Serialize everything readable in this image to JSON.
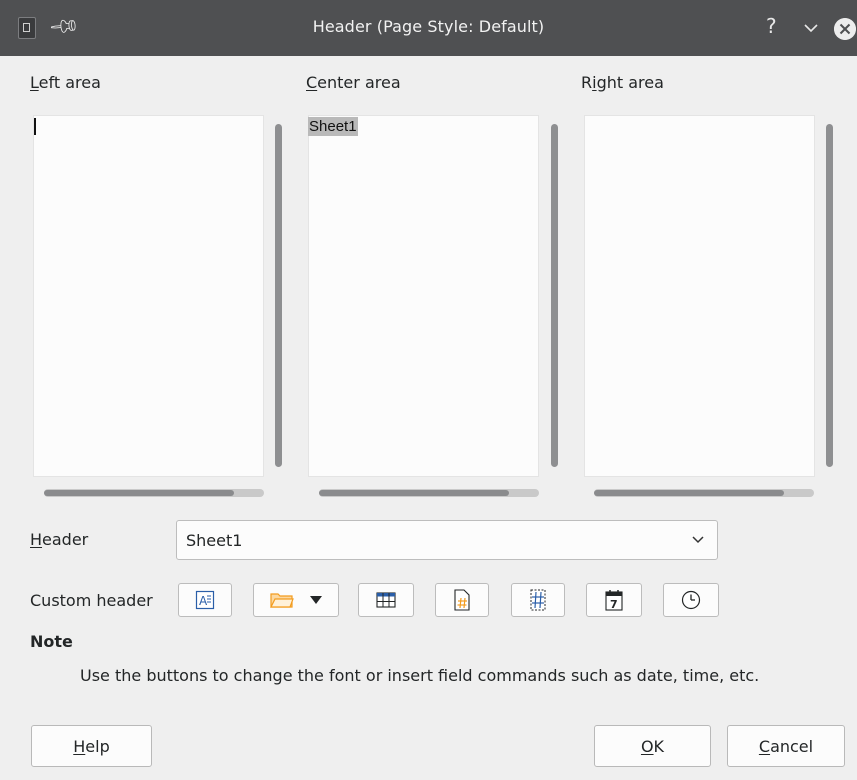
{
  "window": {
    "title": "Header (Page Style: Default)",
    "help_glyph": "?"
  },
  "areas": {
    "left": {
      "label_first": "L",
      "label_rest": "eft area",
      "content": ""
    },
    "center": {
      "label_first": "C",
      "label_rest": "enter area",
      "content": "Sheet1"
    },
    "right": {
      "label_pre": "R",
      "label_mid": "i",
      "label_rest": "ght area",
      "content": ""
    }
  },
  "header": {
    "label_first": "H",
    "label_rest": "eader",
    "selected": "Sheet1"
  },
  "custom_header": {
    "label": "Custom header",
    "tools": [
      "text-attributes-icon",
      "folder-icon",
      "table-icon",
      "page-number-icon",
      "page-count-icon",
      "date-icon",
      "time-icon"
    ]
  },
  "note": {
    "title": "Note",
    "text": "Use the buttons to change the font or insert field commands such as date, time, etc."
  },
  "buttons": {
    "help_first": "H",
    "help_rest": "elp",
    "ok_first": "O",
    "ok_rest": "K",
    "cancel_first": "C",
    "cancel_rest": "ancel"
  },
  "colors": {
    "titlebar": "#4f5052",
    "accent_folder": "#f39c1f",
    "icon_blue": "#2a5ea8"
  }
}
